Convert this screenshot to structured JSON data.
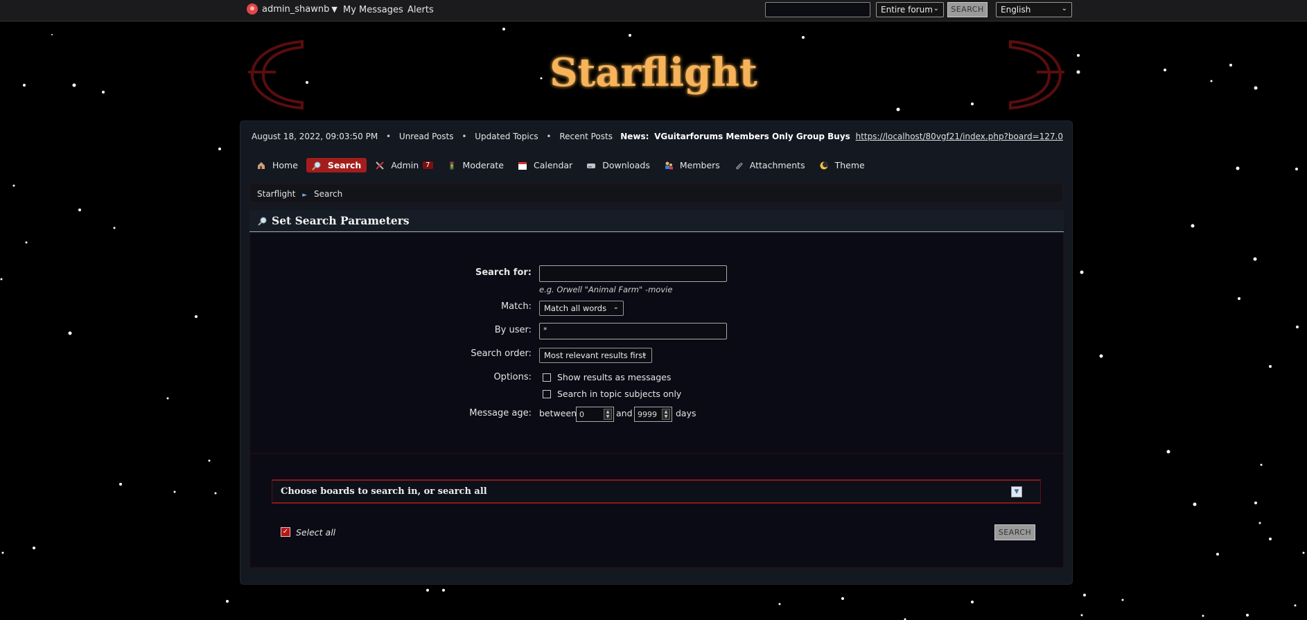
{
  "topbar": {
    "username": "admin_shawnb",
    "caret": "▼",
    "messages": "My Messages",
    "alerts": "Alerts",
    "search_value": "",
    "scope": "Entire forum",
    "search_button": "SEARCH",
    "language": "English"
  },
  "header": {
    "logo": "Starflight"
  },
  "infobar": {
    "datetime": "August 18, 2022, 09:03:50 PM",
    "links": [
      "Unread Posts",
      "Updated Topics",
      "Recent Posts"
    ],
    "news_label": "News:",
    "news_text": "VGuitarforums Members Only Group Buys",
    "news_link": "https://localhost/80vgf21/index.php?board=127.0"
  },
  "menu": {
    "items": [
      {
        "label": "Home"
      },
      {
        "label": "Search"
      },
      {
        "label": "Admin",
        "badge": "7"
      },
      {
        "label": "Moderate"
      },
      {
        "label": "Calendar"
      },
      {
        "label": "Downloads"
      },
      {
        "label": "Members"
      },
      {
        "label": "Attachments"
      },
      {
        "label": "Theme"
      }
    ]
  },
  "breadcrumb": {
    "items": [
      "Starflight",
      "Search"
    ],
    "sep": "►"
  },
  "section": {
    "title": "Set Search Parameters"
  },
  "form": {
    "search_for_label": "Search for:",
    "search_for_value": "",
    "hint": "e.g. Orwell \"Animal Farm\" -movie",
    "match_label": "Match:",
    "match_value": "Match all words",
    "by_user_label": "By user:",
    "by_user_value": "*",
    "order_label": "Search order:",
    "order_value": "Most relevant results first",
    "options_label": "Options:",
    "opt_messages": "Show results as messages",
    "opt_subjects": "Search in topic subjects only",
    "age_label": "Message age:",
    "age_between": "between",
    "age_min": "0",
    "age_and": "and",
    "age_max": "9999",
    "age_days": "days"
  },
  "boards": {
    "title": "Choose boards to search in, or search all",
    "toggle": "▼",
    "select_all": "Select all",
    "select_all_checked": true,
    "checkmark": "✓",
    "search_button": "SEARCH"
  },
  "colors": {
    "accent": "#a41d1d",
    "logo": "#f7b35a",
    "background": "#000000"
  }
}
